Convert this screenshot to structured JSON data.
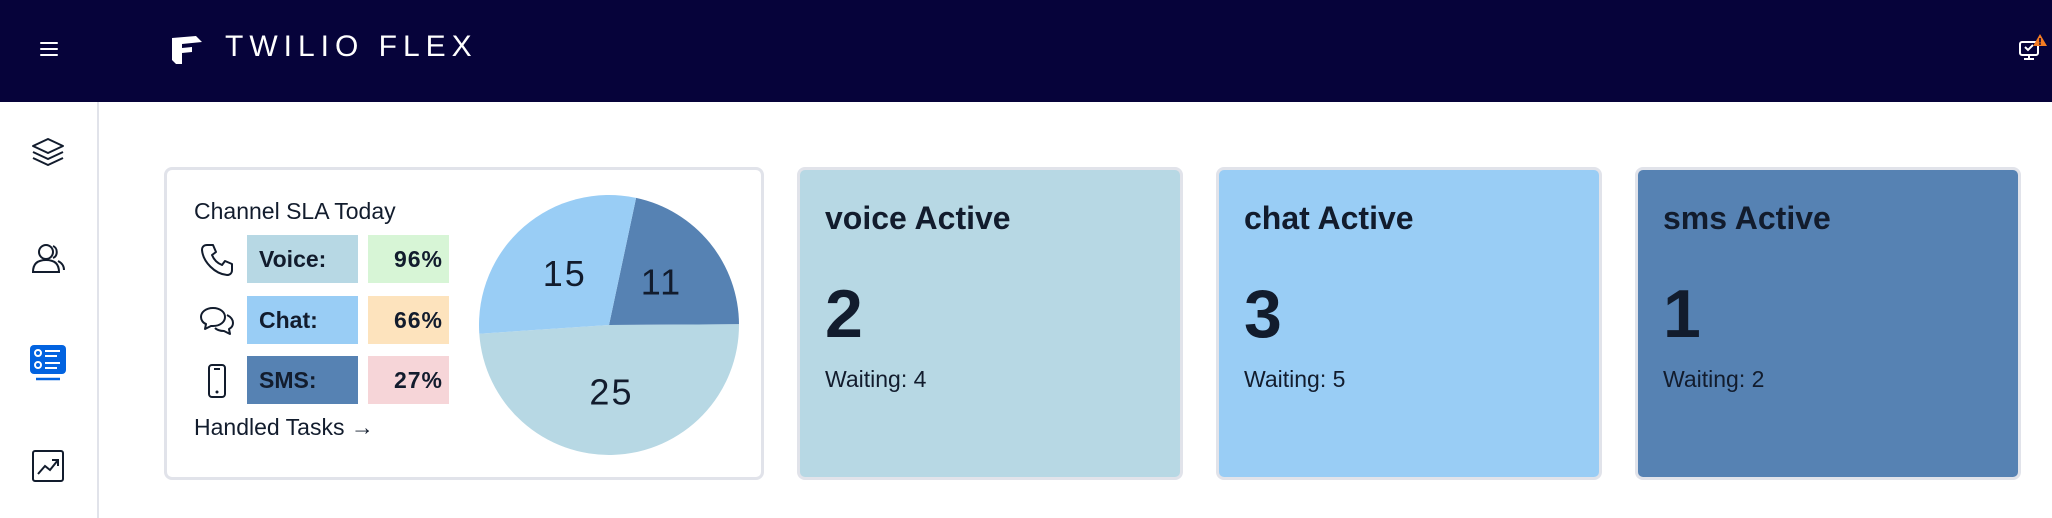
{
  "header": {
    "brand": "TWILIO FLEX",
    "menu_icon": "hamburger-icon",
    "alert_icon": "monitor-alert-icon",
    "background": "#06033a"
  },
  "sidebar": {
    "items": [
      {
        "name": "layers-icon",
        "active": false
      },
      {
        "name": "agents-icon",
        "active": false
      },
      {
        "name": "queues-dashboard-icon",
        "active": true
      },
      {
        "name": "analytics-icon",
        "active": false
      }
    ],
    "active_color": "#0263e0"
  },
  "sla": {
    "title": "Channel SLA Today",
    "channels": [
      {
        "icon": "phone-icon",
        "label": "Voice:",
        "percent": "96%",
        "label_color": "#b7d8e4",
        "pct_color": "#d7f5d6"
      },
      {
        "icon": "chat-icon",
        "label": "Chat:",
        "percent": "66%",
        "label_color": "#99cdf5",
        "pct_color": "#fde3bd"
      },
      {
        "icon": "mobile-icon",
        "label": "SMS:",
        "percent": "27%",
        "label_color": "#5682b3",
        "pct_color": "#f6d5d8"
      }
    ],
    "handled_link": "Handled Tasks →"
  },
  "chart_data": {
    "type": "pie",
    "slices": [
      {
        "value": 11,
        "color": "#5682b3"
      },
      {
        "value": 25,
        "color": "#b7d8e4"
      },
      {
        "value": 15,
        "color": "#99cdf5"
      }
    ]
  },
  "active": [
    {
      "title": "voice Active",
      "count": "2",
      "waiting": "Waiting: 4",
      "color": "#b7d8e4"
    },
    {
      "title": "chat Active",
      "count": "3",
      "waiting": "Waiting: 5",
      "color": "#99cdf5"
    },
    {
      "title": "sms Active",
      "count": "1",
      "waiting": "Waiting: 2",
      "color": "#5682b3"
    }
  ]
}
